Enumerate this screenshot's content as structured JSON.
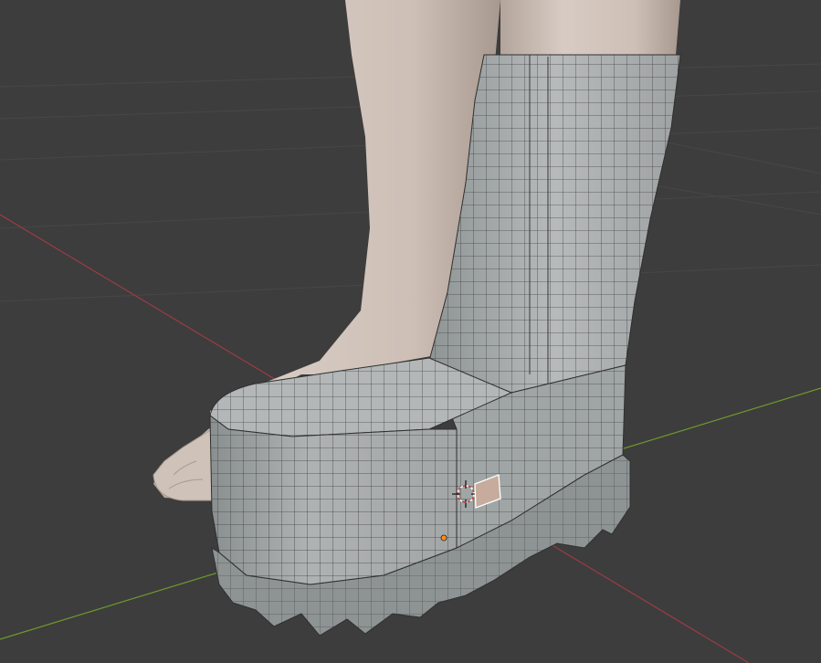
{
  "viewport": {
    "mode": "3d-viewport",
    "background": "#3d3d3d",
    "grid_color": "#4a4a4a",
    "x_axis_color": "#9c3b46",
    "y_axis_color": "#6e9a2d"
  },
  "scene": {
    "objects": [
      {
        "name": "leg-mesh",
        "color": "#c9bdb5"
      },
      {
        "name": "boot-mesh",
        "color": "#a9adad",
        "wire_color": "#333333"
      }
    ],
    "cursor_icon": "3d-cursor-icon",
    "origin_icon": "object-origin-icon",
    "origin_color": "#ff8c1a"
  }
}
